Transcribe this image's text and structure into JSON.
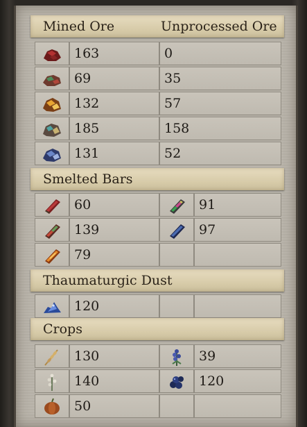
{
  "sections": {
    "mined": {
      "col1": "Mined Ore",
      "col2": "Unprocessed Ore"
    },
    "bars": {
      "title": "Smelted Bars"
    },
    "dust": {
      "title": "Thaumaturgic Dust"
    },
    "crops": {
      "title": "Crops"
    }
  },
  "ore_rows": [
    {
      "icon": "red-ore-icon",
      "mined": "163",
      "unprocessed": "0"
    },
    {
      "icon": "green-red-ore-icon",
      "mined": "69",
      "unprocessed": "35"
    },
    {
      "icon": "gold-ore-icon",
      "mined": "132",
      "unprocessed": "57"
    },
    {
      "icon": "teal-ore-icon",
      "mined": "185",
      "unprocessed": "158"
    },
    {
      "icon": "blue-ore-icon",
      "mined": "131",
      "unprocessed": "52"
    }
  ],
  "bar_rows": [
    {
      "icon1": "red-bar-icon",
      "val1": "60",
      "icon2": "rainbow-bar-icon",
      "val2": "91"
    },
    {
      "icon1": "red-green-bar-icon",
      "val1": "139",
      "icon2": "blue-bar-icon",
      "val2": "97"
    },
    {
      "icon1": "orange-bar-icon",
      "val1": "79"
    }
  ],
  "dust_rows": [
    {
      "icon1": "blue-dust-icon",
      "val1": "120"
    }
  ],
  "crop_rows": [
    {
      "icon1": "wheat-icon",
      "val1": "130",
      "icon2": "blue-flower-icon",
      "val2": "39"
    },
    {
      "icon1": "white-herb-icon",
      "val1": "140",
      "icon2": "blue-berries-icon",
      "val2": "120"
    },
    {
      "icon1": "pumpkin-icon",
      "val1": "50"
    }
  ],
  "colors": {
    "parchment": "#d8ccaa",
    "cell": "#c4bfb5",
    "text": "#1e1a16"
  }
}
